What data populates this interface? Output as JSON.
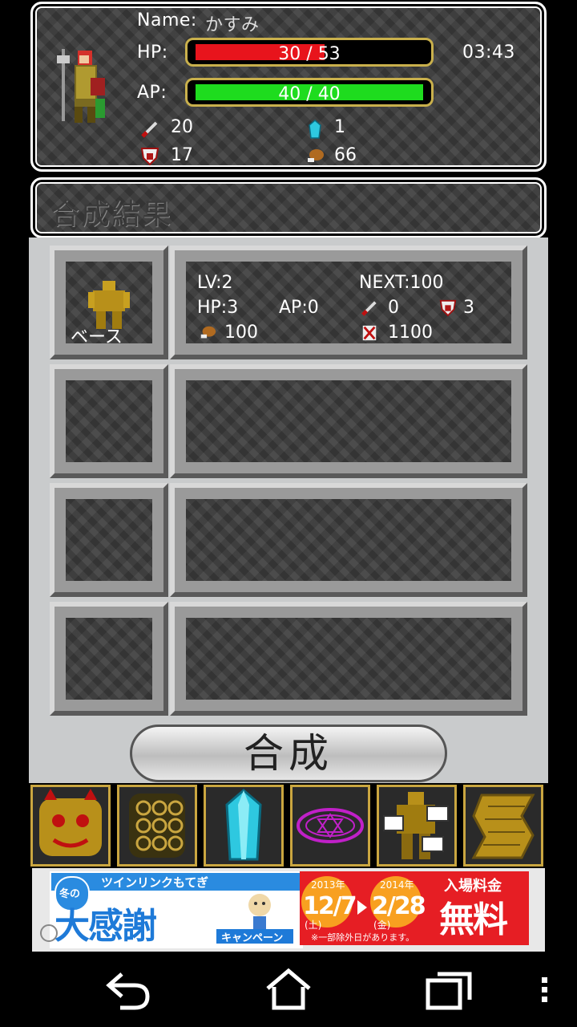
{
  "status": {
    "name_label": "Name:",
    "name_value": "かすみ",
    "hp_label": "HP:",
    "hp_text": "30 / 53",
    "hp_fraction": 0.566,
    "ap_label": "AP:",
    "ap_text": "40 / 40",
    "ap_fraction": 1.0,
    "time": "03:43",
    "attack": "20",
    "crystals": "1",
    "defense": "17",
    "food": "66",
    "colors": {
      "hp": "#e8141c",
      "ap": "#1edc1e",
      "bar_border": "#c9b04c"
    }
  },
  "title": "合成結果",
  "slots": [
    {
      "label": "ベース",
      "lv": "LV:2",
      "next": "NEXT:100",
      "hp": "HP:3",
      "ap": "AP:0",
      "attack": "0",
      "defense": "3",
      "food": "100",
      "cost": "1100"
    },
    {},
    {},
    {}
  ],
  "synth_button": "合成",
  "menu": [
    {
      "icon": "monster-face-icon"
    },
    {
      "icon": "gold-mesh-icon"
    },
    {
      "icon": "crystal-icon"
    },
    {
      "icon": "magic-circle-icon"
    },
    {
      "icon": "golem-cards-icon"
    },
    {
      "icon": "scroll-map-icon"
    }
  ],
  "ad": {
    "top": "ツインリンクもてぎ",
    "season": "冬の",
    "main": "大感謝",
    "sub": "キャンペーン",
    "year1": "2013年",
    "date1": "12/7",
    "day1": "(土)",
    "year2": "2014年",
    "date2": "2/28",
    "day2": "(金)",
    "right_top": "入場料金",
    "right_main": "無料",
    "note": "※一部除外日があります。"
  },
  "nav": {
    "back": "back-icon",
    "home": "home-icon",
    "recent": "recent-apps-icon",
    "menu": "overflow-menu-icon"
  }
}
